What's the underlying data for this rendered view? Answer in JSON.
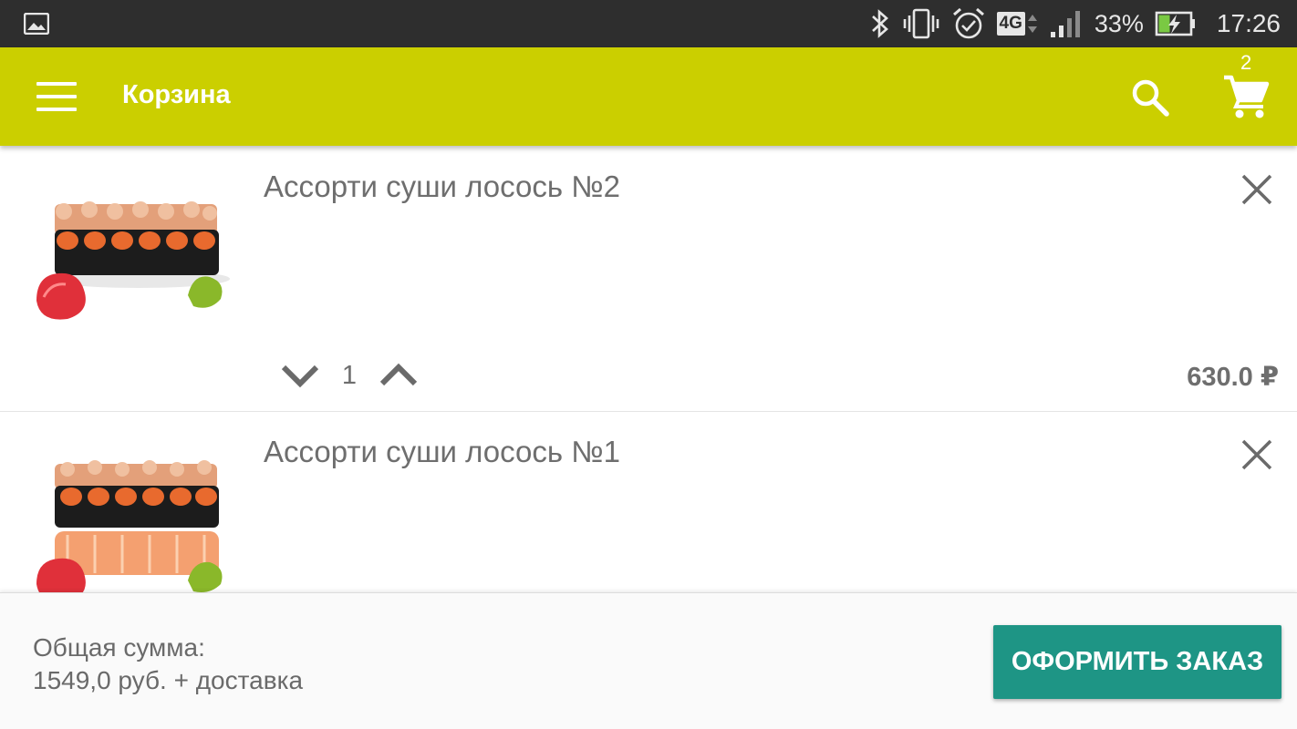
{
  "status_bar": {
    "battery_percent": "33%",
    "time": "17:26",
    "network": "4G",
    "icons": [
      "image-notification-icon",
      "bluetooth-icon",
      "vibrate-icon",
      "alarm-icon",
      "network-4g-icon",
      "signal-icon",
      "battery-charging-icon"
    ]
  },
  "toolbar": {
    "title": "Корзина",
    "cart_badge": "2",
    "background": "#cbcf00"
  },
  "cart": {
    "items": [
      {
        "name": "Ассорти суши лосось №2",
        "quantity": "1",
        "price": "630.0 ₽"
      },
      {
        "name": "Ассорти суши лосось №1"
      }
    ]
  },
  "summary": {
    "total_label": "Общая сумма:",
    "total_value": "1549,0 руб. + доставка",
    "checkout_label": "ОФОРМИТЬ ЗАКАЗ",
    "checkout_color": "#1e9585"
  }
}
